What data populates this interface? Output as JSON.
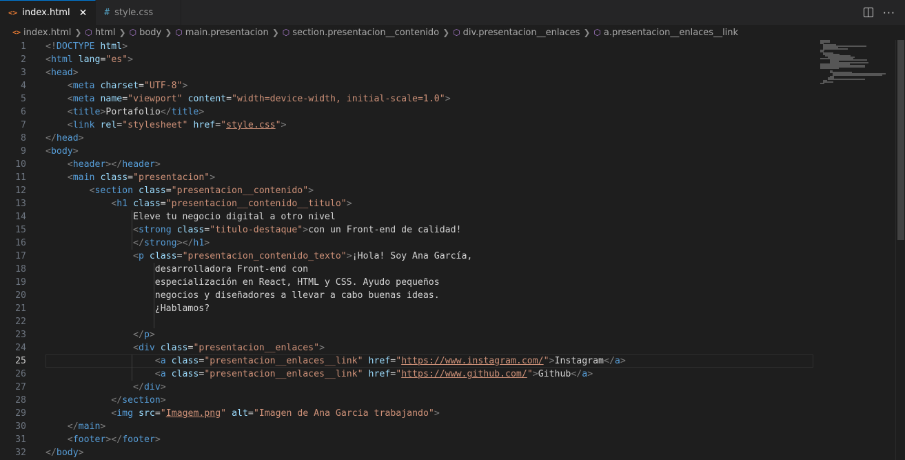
{
  "tabs": [
    {
      "label": "index.html",
      "icon": "html-file-icon",
      "active": true
    },
    {
      "label": "style.css",
      "icon": "css-file-icon",
      "active": false
    }
  ],
  "breadcrumb": [
    "index.html",
    "html",
    "body",
    "main.presentacion",
    "section.presentacion__contenido",
    "div.presentacion__enlaces",
    "a.presentacion__enlaces__link"
  ],
  "editor": {
    "active_line": 25,
    "lines": [
      {
        "n": "1",
        "tokens": [
          [
            "p",
            "<!"
          ],
          [
            "t",
            "DOCTYPE"
          ],
          [
            "x",
            " "
          ],
          [
            "a",
            "html"
          ],
          [
            "p",
            ">"
          ]
        ]
      },
      {
        "n": "2",
        "tokens": [
          [
            "p",
            "<"
          ],
          [
            "t",
            "html"
          ],
          [
            "x",
            " "
          ],
          [
            "a",
            "lang"
          ],
          [
            "x",
            "="
          ],
          [
            "s",
            "\"es\""
          ],
          [
            "p",
            ">"
          ]
        ]
      },
      {
        "n": "3",
        "tokens": [
          [
            "p",
            "<"
          ],
          [
            "t",
            "head"
          ],
          [
            "p",
            ">"
          ]
        ]
      },
      {
        "n": "4",
        "tokens": [
          [
            "x",
            "    "
          ],
          [
            "p",
            "<"
          ],
          [
            "t",
            "meta"
          ],
          [
            "x",
            " "
          ],
          [
            "a",
            "charset"
          ],
          [
            "x",
            "="
          ],
          [
            "s",
            "\"UTF-8\""
          ],
          [
            "p",
            ">"
          ]
        ]
      },
      {
        "n": "5",
        "tokens": [
          [
            "x",
            "    "
          ],
          [
            "p",
            "<"
          ],
          [
            "t",
            "meta"
          ],
          [
            "x",
            " "
          ],
          [
            "a",
            "name"
          ],
          [
            "x",
            "="
          ],
          [
            "s",
            "\"viewport\""
          ],
          [
            "x",
            " "
          ],
          [
            "a",
            "content"
          ],
          [
            "x",
            "="
          ],
          [
            "s",
            "\"width=device-width, initial-scale=1.0\""
          ],
          [
            "p",
            ">"
          ]
        ]
      },
      {
        "n": "6",
        "tokens": [
          [
            "x",
            "    "
          ],
          [
            "p",
            "<"
          ],
          [
            "t",
            "title"
          ],
          [
            "p",
            ">"
          ],
          [
            "x",
            "Portafolio"
          ],
          [
            "p",
            "</"
          ],
          [
            "t",
            "title"
          ],
          [
            "p",
            ">"
          ]
        ]
      },
      {
        "n": "7",
        "tokens": [
          [
            "x",
            "    "
          ],
          [
            "p",
            "<"
          ],
          [
            "t",
            "link"
          ],
          [
            "x",
            " "
          ],
          [
            "a",
            "rel"
          ],
          [
            "x",
            "="
          ],
          [
            "s",
            "\"stylesheet\""
          ],
          [
            "x",
            " "
          ],
          [
            "a",
            "href"
          ],
          [
            "x",
            "="
          ],
          [
            "s",
            "\""
          ],
          [
            "u",
            "style.css"
          ],
          [
            "s",
            "\""
          ],
          [
            "p",
            ">"
          ]
        ]
      },
      {
        "n": "8",
        "tokens": [
          [
            "p",
            "</"
          ],
          [
            "t",
            "head"
          ],
          [
            "p",
            ">"
          ]
        ]
      },
      {
        "n": "9",
        "tokens": [
          [
            "p",
            "<"
          ],
          [
            "t",
            "body"
          ],
          [
            "p",
            ">"
          ]
        ]
      },
      {
        "n": "10",
        "tokens": [
          [
            "x",
            "    "
          ],
          [
            "p",
            "<"
          ],
          [
            "t",
            "header"
          ],
          [
            "p",
            "></"
          ],
          [
            "t",
            "header"
          ],
          [
            "p",
            ">"
          ]
        ]
      },
      {
        "n": "11",
        "tokens": [
          [
            "x",
            "    "
          ],
          [
            "p",
            "<"
          ],
          [
            "t",
            "main"
          ],
          [
            "x",
            " "
          ],
          [
            "a",
            "class"
          ],
          [
            "x",
            "="
          ],
          [
            "s",
            "\"presentacion\""
          ],
          [
            "p",
            ">"
          ]
        ]
      },
      {
        "n": "12",
        "tokens": [
          [
            "x",
            "        "
          ],
          [
            "p",
            "<"
          ],
          [
            "t",
            "section"
          ],
          [
            "x",
            " "
          ],
          [
            "a",
            "class"
          ],
          [
            "x",
            "="
          ],
          [
            "s",
            "\"presentacion__contenido\""
          ],
          [
            "p",
            ">"
          ]
        ]
      },
      {
        "n": "13",
        "tokens": [
          [
            "x",
            "            "
          ],
          [
            "p",
            "<"
          ],
          [
            "t",
            "h1"
          ],
          [
            "x",
            " "
          ],
          [
            "a",
            "class"
          ],
          [
            "x",
            "="
          ],
          [
            "s",
            "\"presentacion__contenido__titulo\""
          ],
          [
            "p",
            ">"
          ]
        ]
      },
      {
        "n": "14",
        "tokens": [
          [
            "x",
            "                Eleve tu negocio digital a otro nivel"
          ]
        ]
      },
      {
        "n": "15",
        "tokens": [
          [
            "x",
            "                "
          ],
          [
            "p",
            "<"
          ],
          [
            "t",
            "strong"
          ],
          [
            "x",
            " "
          ],
          [
            "a",
            "class"
          ],
          [
            "x",
            "="
          ],
          [
            "s",
            "\"titulo-destaque\""
          ],
          [
            "p",
            ">"
          ],
          [
            "x",
            "con un Front-end de calidad!"
          ]
        ]
      },
      {
        "n": "16",
        "tokens": [
          [
            "x",
            "                "
          ],
          [
            "p",
            "</"
          ],
          [
            "t",
            "strong"
          ],
          [
            "p",
            "></"
          ],
          [
            "t",
            "h1"
          ],
          [
            "p",
            ">"
          ]
        ]
      },
      {
        "n": "17",
        "tokens": [
          [
            "x",
            "                "
          ],
          [
            "p",
            "<"
          ],
          [
            "t",
            "p"
          ],
          [
            "x",
            " "
          ],
          [
            "a",
            "class"
          ],
          [
            "x",
            "="
          ],
          [
            "s",
            "\"presentacion_contenido_texto\""
          ],
          [
            "p",
            ">"
          ],
          [
            "x",
            "¡Hola! Soy Ana García,"
          ]
        ]
      },
      {
        "n": "18",
        "tokens": [
          [
            "x",
            "                    desarrolladora Front-end con"
          ]
        ]
      },
      {
        "n": "19",
        "tokens": [
          [
            "x",
            "                    especialización en React, HTML y CSS. Ayudo pequeños"
          ]
        ]
      },
      {
        "n": "20",
        "tokens": [
          [
            "x",
            "                    negocios y diseñadores a llevar a cabo buenas ideas."
          ]
        ]
      },
      {
        "n": "21",
        "tokens": [
          [
            "x",
            "                    ¿Hablamos?"
          ]
        ]
      },
      {
        "n": "22",
        "tokens": []
      },
      {
        "n": "23",
        "tokens": [
          [
            "x",
            "                "
          ],
          [
            "p",
            "</"
          ],
          [
            "t",
            "p"
          ],
          [
            "p",
            ">"
          ]
        ]
      },
      {
        "n": "24",
        "tokens": [
          [
            "x",
            "                "
          ],
          [
            "p",
            "<"
          ],
          [
            "t",
            "div"
          ],
          [
            "x",
            " "
          ],
          [
            "a",
            "class"
          ],
          [
            "x",
            "="
          ],
          [
            "s",
            "\"presentacion__enlaces\""
          ],
          [
            "p",
            ">"
          ]
        ]
      },
      {
        "n": "25",
        "tokens": [
          [
            "x",
            "                    "
          ],
          [
            "p",
            "<"
          ],
          [
            "t",
            "a"
          ],
          [
            "x",
            " "
          ],
          [
            "a",
            "class"
          ],
          [
            "x",
            "="
          ],
          [
            "s",
            "\"presentacion__enlaces__link\""
          ],
          [
            "x",
            " "
          ],
          [
            "a",
            "href"
          ],
          [
            "x",
            "="
          ],
          [
            "s",
            "\""
          ],
          [
            "u",
            "https://www.instagram.com/"
          ],
          [
            "s",
            "\""
          ],
          [
            "p",
            ">"
          ],
          [
            "x",
            "Instagram"
          ],
          [
            "p",
            "</"
          ],
          [
            "t",
            "a"
          ],
          [
            "p",
            ">"
          ]
        ]
      },
      {
        "n": "26",
        "tokens": [
          [
            "x",
            "                    "
          ],
          [
            "p",
            "<"
          ],
          [
            "t",
            "a"
          ],
          [
            "x",
            " "
          ],
          [
            "a",
            "class"
          ],
          [
            "x",
            "="
          ],
          [
            "s",
            "\"presentacion__enlaces__link\""
          ],
          [
            "x",
            " "
          ],
          [
            "a",
            "href"
          ],
          [
            "x",
            "="
          ],
          [
            "s",
            "\""
          ],
          [
            "u",
            "https://www.github.com/"
          ],
          [
            "s",
            "\""
          ],
          [
            "p",
            ">"
          ],
          [
            "x",
            "Github"
          ],
          [
            "p",
            "</"
          ],
          [
            "t",
            "a"
          ],
          [
            "p",
            ">"
          ]
        ]
      },
      {
        "n": "27",
        "tokens": [
          [
            "x",
            "                "
          ],
          [
            "p",
            "</"
          ],
          [
            "t",
            "div"
          ],
          [
            "p",
            ">"
          ]
        ]
      },
      {
        "n": "28",
        "tokens": [
          [
            "x",
            "            "
          ],
          [
            "p",
            "</"
          ],
          [
            "t",
            "section"
          ],
          [
            "p",
            ">"
          ]
        ]
      },
      {
        "n": "29",
        "tokens": [
          [
            "x",
            "            "
          ],
          [
            "p",
            "<"
          ],
          [
            "t",
            "img"
          ],
          [
            "x",
            " "
          ],
          [
            "a",
            "src"
          ],
          [
            "x",
            "="
          ],
          [
            "s",
            "\""
          ],
          [
            "u",
            "Imagem.png"
          ],
          [
            "s",
            "\""
          ],
          [
            "x",
            " "
          ],
          [
            "a",
            "alt"
          ],
          [
            "x",
            "="
          ],
          [
            "s",
            "\"Imagen de Ana Garcia trabajando\""
          ],
          [
            "p",
            ">"
          ]
        ]
      },
      {
        "n": "30",
        "tokens": [
          [
            "x",
            "    "
          ],
          [
            "p",
            "</"
          ],
          [
            "t",
            "main"
          ],
          [
            "p",
            ">"
          ]
        ]
      },
      {
        "n": "31",
        "tokens": [
          [
            "x",
            "    "
          ],
          [
            "p",
            "<"
          ],
          [
            "t",
            "footer"
          ],
          [
            "p",
            "></"
          ],
          [
            "t",
            "footer"
          ],
          [
            "p",
            ">"
          ]
        ]
      },
      {
        "n": "32",
        "tokens": [
          [
            "p",
            "</"
          ],
          [
            "t",
            "body"
          ],
          [
            "p",
            ">"
          ]
        ]
      }
    ]
  },
  "colors": {
    "background": "#1e1e1e",
    "tag": "#569cd6",
    "attribute": "#9cdcfe",
    "string": "#ce9178",
    "text": "#d4d4d4",
    "punctuation": "#808080",
    "accent": "#0078d4"
  }
}
